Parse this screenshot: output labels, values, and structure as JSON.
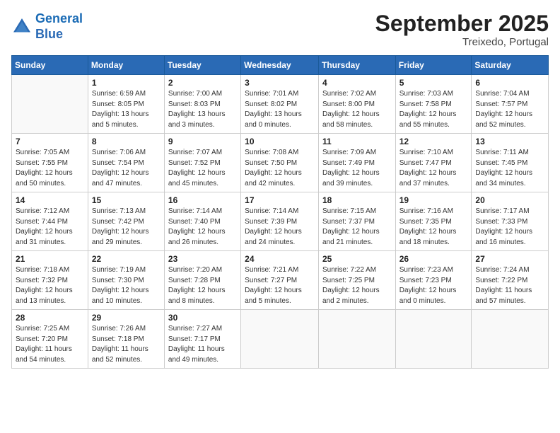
{
  "header": {
    "logo_line1": "General",
    "logo_line2": "Blue",
    "month": "September 2025",
    "location": "Treixedo, Portugal"
  },
  "columns": [
    "Sunday",
    "Monday",
    "Tuesday",
    "Wednesday",
    "Thursday",
    "Friday",
    "Saturday"
  ],
  "weeks": [
    [
      {
        "day": "",
        "info": ""
      },
      {
        "day": "1",
        "info": "Sunrise: 6:59 AM\nSunset: 8:05 PM\nDaylight: 13 hours\nand 5 minutes."
      },
      {
        "day": "2",
        "info": "Sunrise: 7:00 AM\nSunset: 8:03 PM\nDaylight: 13 hours\nand 3 minutes."
      },
      {
        "day": "3",
        "info": "Sunrise: 7:01 AM\nSunset: 8:02 PM\nDaylight: 13 hours\nand 0 minutes."
      },
      {
        "day": "4",
        "info": "Sunrise: 7:02 AM\nSunset: 8:00 PM\nDaylight: 12 hours\nand 58 minutes."
      },
      {
        "day": "5",
        "info": "Sunrise: 7:03 AM\nSunset: 7:58 PM\nDaylight: 12 hours\nand 55 minutes."
      },
      {
        "day": "6",
        "info": "Sunrise: 7:04 AM\nSunset: 7:57 PM\nDaylight: 12 hours\nand 52 minutes."
      }
    ],
    [
      {
        "day": "7",
        "info": "Sunrise: 7:05 AM\nSunset: 7:55 PM\nDaylight: 12 hours\nand 50 minutes."
      },
      {
        "day": "8",
        "info": "Sunrise: 7:06 AM\nSunset: 7:54 PM\nDaylight: 12 hours\nand 47 minutes."
      },
      {
        "day": "9",
        "info": "Sunrise: 7:07 AM\nSunset: 7:52 PM\nDaylight: 12 hours\nand 45 minutes."
      },
      {
        "day": "10",
        "info": "Sunrise: 7:08 AM\nSunset: 7:50 PM\nDaylight: 12 hours\nand 42 minutes."
      },
      {
        "day": "11",
        "info": "Sunrise: 7:09 AM\nSunset: 7:49 PM\nDaylight: 12 hours\nand 39 minutes."
      },
      {
        "day": "12",
        "info": "Sunrise: 7:10 AM\nSunset: 7:47 PM\nDaylight: 12 hours\nand 37 minutes."
      },
      {
        "day": "13",
        "info": "Sunrise: 7:11 AM\nSunset: 7:45 PM\nDaylight: 12 hours\nand 34 minutes."
      }
    ],
    [
      {
        "day": "14",
        "info": "Sunrise: 7:12 AM\nSunset: 7:44 PM\nDaylight: 12 hours\nand 31 minutes."
      },
      {
        "day": "15",
        "info": "Sunrise: 7:13 AM\nSunset: 7:42 PM\nDaylight: 12 hours\nand 29 minutes."
      },
      {
        "day": "16",
        "info": "Sunrise: 7:14 AM\nSunset: 7:40 PM\nDaylight: 12 hours\nand 26 minutes."
      },
      {
        "day": "17",
        "info": "Sunrise: 7:14 AM\nSunset: 7:39 PM\nDaylight: 12 hours\nand 24 minutes."
      },
      {
        "day": "18",
        "info": "Sunrise: 7:15 AM\nSunset: 7:37 PM\nDaylight: 12 hours\nand 21 minutes."
      },
      {
        "day": "19",
        "info": "Sunrise: 7:16 AM\nSunset: 7:35 PM\nDaylight: 12 hours\nand 18 minutes."
      },
      {
        "day": "20",
        "info": "Sunrise: 7:17 AM\nSunset: 7:33 PM\nDaylight: 12 hours\nand 16 minutes."
      }
    ],
    [
      {
        "day": "21",
        "info": "Sunrise: 7:18 AM\nSunset: 7:32 PM\nDaylight: 12 hours\nand 13 minutes."
      },
      {
        "day": "22",
        "info": "Sunrise: 7:19 AM\nSunset: 7:30 PM\nDaylight: 12 hours\nand 10 minutes."
      },
      {
        "day": "23",
        "info": "Sunrise: 7:20 AM\nSunset: 7:28 PM\nDaylight: 12 hours\nand 8 minutes."
      },
      {
        "day": "24",
        "info": "Sunrise: 7:21 AM\nSunset: 7:27 PM\nDaylight: 12 hours\nand 5 minutes."
      },
      {
        "day": "25",
        "info": "Sunrise: 7:22 AM\nSunset: 7:25 PM\nDaylight: 12 hours\nand 2 minutes."
      },
      {
        "day": "26",
        "info": "Sunrise: 7:23 AM\nSunset: 7:23 PM\nDaylight: 12 hours\nand 0 minutes."
      },
      {
        "day": "27",
        "info": "Sunrise: 7:24 AM\nSunset: 7:22 PM\nDaylight: 11 hours\nand 57 minutes."
      }
    ],
    [
      {
        "day": "28",
        "info": "Sunrise: 7:25 AM\nSunset: 7:20 PM\nDaylight: 11 hours\nand 54 minutes."
      },
      {
        "day": "29",
        "info": "Sunrise: 7:26 AM\nSunset: 7:18 PM\nDaylight: 11 hours\nand 52 minutes."
      },
      {
        "day": "30",
        "info": "Sunrise: 7:27 AM\nSunset: 7:17 PM\nDaylight: 11 hours\nand 49 minutes."
      },
      {
        "day": "",
        "info": ""
      },
      {
        "day": "",
        "info": ""
      },
      {
        "day": "",
        "info": ""
      },
      {
        "day": "",
        "info": ""
      }
    ]
  ]
}
